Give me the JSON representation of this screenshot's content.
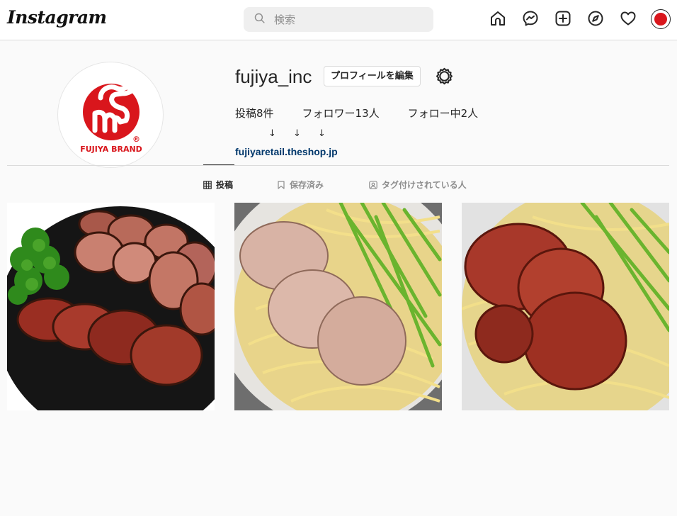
{
  "app": {
    "logo": "Instagram"
  },
  "search": {
    "placeholder": "検索"
  },
  "nav": {
    "icons": [
      "home-icon",
      "messenger-icon",
      "new-post-icon",
      "explore-icon",
      "activity-heart-icon",
      "profile-avatar"
    ]
  },
  "profile": {
    "username": "fujiya_inc",
    "edit_label": "プロフィールを編集",
    "stats": {
      "posts": "投稿8件",
      "followers": "フォロワー13人",
      "following": "フォロー中2人"
    },
    "bio_arrows": "↓ ↓ ↓",
    "link": "fujiyaretail.theshop.jp",
    "logo_text": "FUJIYA BRAND",
    "logo_mark": "®"
  },
  "tabs": [
    {
      "label": "投稿",
      "icon": "grid-icon",
      "active": true
    },
    {
      "label": "保存済み",
      "icon": "bookmark-icon",
      "active": false
    },
    {
      "label": "タグ付けされている人",
      "icon": "tagged-user-icon",
      "active": false
    }
  ],
  "colors": {
    "brand_red": "#d9161c",
    "link": "#00376b",
    "border": "#dbdbdb"
  }
}
